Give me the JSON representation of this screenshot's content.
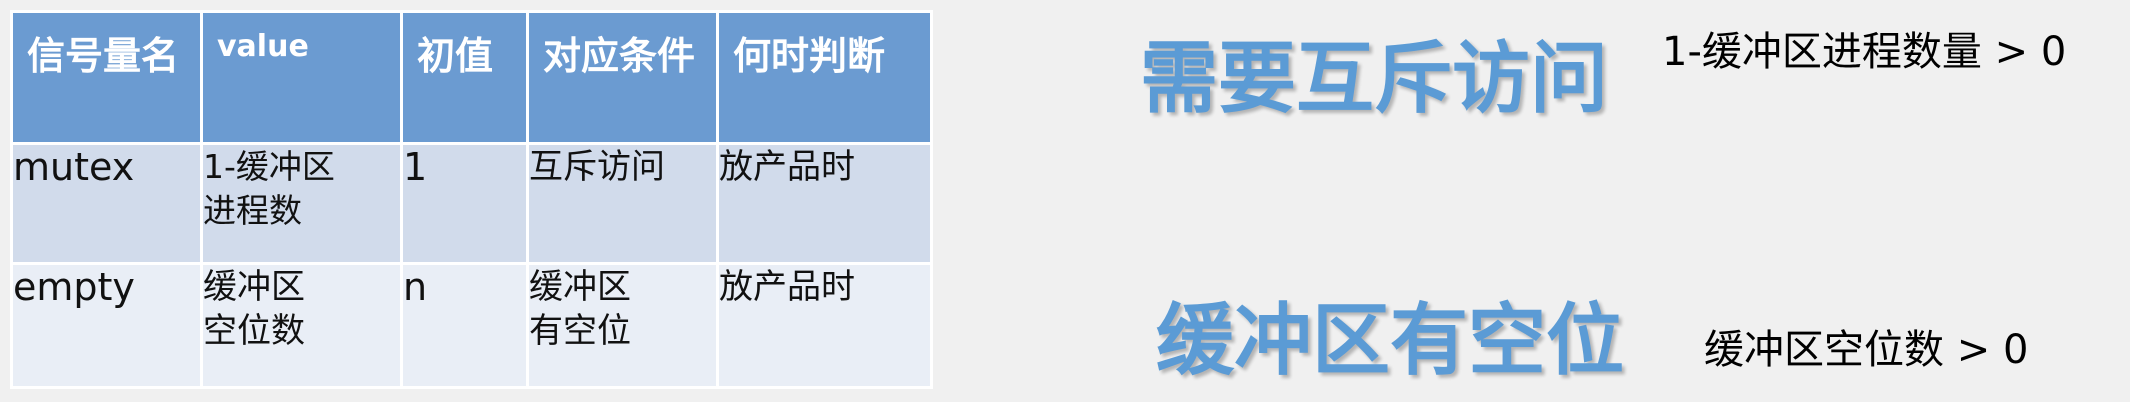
{
  "table": {
    "headers": [
      "信号量名",
      "value",
      "初值",
      "对应条件",
      "何时判断"
    ],
    "rows": [
      {
        "name": "mutex",
        "value_line1": "1-缓冲区",
        "value_line2": "进程数",
        "initial": "1",
        "condition_line1": "互斥访问",
        "condition_line2": "",
        "when": "放产品时"
      },
      {
        "name": "empty",
        "value_line1": "缓冲区",
        "value_line2": "空位数",
        "initial": "n",
        "condition_line1": "缓冲区",
        "condition_line2": "有空位",
        "when": "放产品时"
      }
    ]
  },
  "annotations": [
    {
      "heading": "需要互斥访问",
      "formula": "1-缓冲区进程数量 > 0"
    },
    {
      "heading": "缓冲区有空位",
      "formula": "缓冲区空位数 > 0"
    }
  ],
  "colors": {
    "header_bg": "#6b9bd1",
    "row1_bg": "#d1dbeb",
    "row2_bg": "#e9eef6",
    "heading_text": "#5b9bd5",
    "page_bg": "#f0f0f0"
  }
}
